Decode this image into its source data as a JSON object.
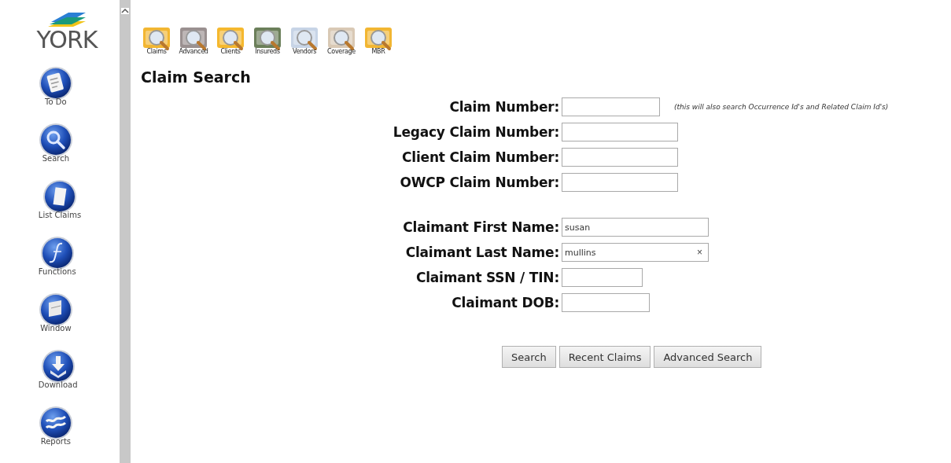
{
  "logo": {
    "text": "YORK"
  },
  "sidebar": {
    "items": [
      {
        "label": "To Do"
      },
      {
        "label": "Search"
      },
      {
        "label": "List Claims"
      },
      {
        "label": "Functions"
      },
      {
        "label": "Window"
      },
      {
        "label": "Download"
      },
      {
        "label": "Reports"
      }
    ]
  },
  "toolbar": {
    "items": [
      {
        "label": "Claims"
      },
      {
        "label": "Advanced"
      },
      {
        "label": "Clients"
      },
      {
        "label": "Insureds"
      },
      {
        "label": "Vendors"
      },
      {
        "label": "Coverage"
      },
      {
        "label": "MBR"
      }
    ]
  },
  "page_title": "Claim Search",
  "form": {
    "groups": [
      {
        "fields": [
          {
            "label": "Claim Number:",
            "note": "(this will also search Occurrence Id's and Related Claim Id's)"
          },
          {
            "label": "Legacy Claim Number:"
          },
          {
            "label": "Client Claim Number:"
          },
          {
            "label": "OWCP Claim Number:"
          }
        ]
      },
      {
        "fields": [
          {
            "label": "Claimant First Name:",
            "value": "susan"
          },
          {
            "label": "Claimant Last Name:",
            "value": "mullins",
            "clear_button": "×"
          },
          {
            "label": "Claimant SSN / TIN:"
          },
          {
            "label": "Claimant DOB:"
          }
        ]
      }
    ],
    "buttons": [
      "Search",
      "Recent Claims",
      "Advanced Search"
    ]
  }
}
